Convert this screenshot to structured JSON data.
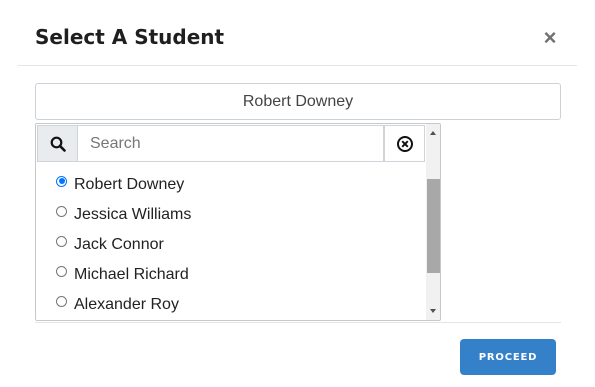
{
  "dialog": {
    "title": "Select A Student",
    "close_label": "×"
  },
  "selected_student": "Robert Downey",
  "search": {
    "placeholder": "Search",
    "value": ""
  },
  "students": [
    {
      "name": "Robert Downey",
      "selected": true
    },
    {
      "name": "Jessica Williams",
      "selected": false
    },
    {
      "name": "Jack Connor",
      "selected": false
    },
    {
      "name": "Michael Richard",
      "selected": false
    },
    {
      "name": "Alexander Roy",
      "selected": false
    }
  ],
  "footer": {
    "proceed_label": "PROCEED"
  },
  "colors": {
    "accent": "#3581c9",
    "radio_checked": "#0075ff"
  },
  "icons": [
    "search-icon",
    "clear-search-icon",
    "close-icon",
    "scroll-up-icon",
    "scroll-down-icon"
  ]
}
